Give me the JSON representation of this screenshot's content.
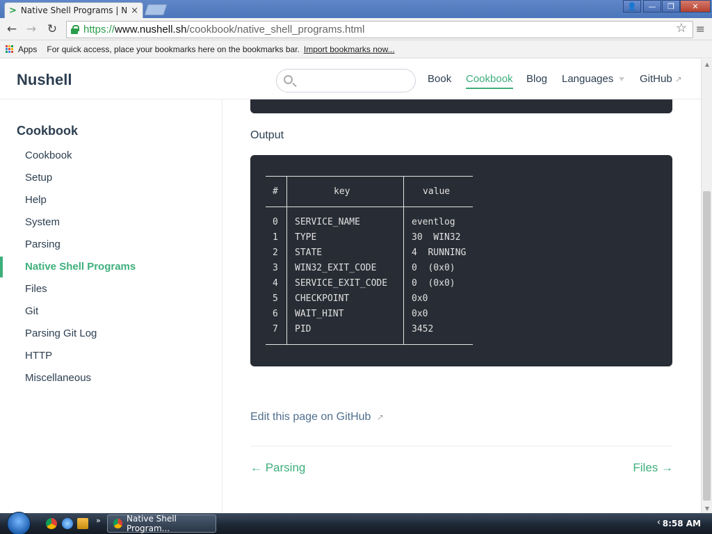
{
  "browser": {
    "tab_title": "Native Shell Programs | Nu",
    "tab_close": "×",
    "window_controls": [
      "👤",
      "—",
      "❐",
      "✕"
    ],
    "url_https": "https://",
    "url_host": "www.nushell.sh",
    "url_path": "/cookbook/native_shell_programs.html",
    "bookmarks": {
      "apps_label": "Apps",
      "hint": "For quick access, place your bookmarks here on the bookmarks bar.",
      "import_link": "Import bookmarks now..."
    }
  },
  "site": {
    "brand": "Nushell",
    "search_placeholder": "",
    "nav": [
      {
        "label": "Book"
      },
      {
        "label": "Cookbook"
      },
      {
        "label": "Blog"
      },
      {
        "label": "Languages"
      },
      {
        "label": "GitHub"
      }
    ]
  },
  "sidebar": {
    "title": "Cookbook",
    "items": [
      {
        "label": "Cookbook"
      },
      {
        "label": "Setup"
      },
      {
        "label": "Help"
      },
      {
        "label": "System"
      },
      {
        "label": "Parsing"
      },
      {
        "label": "Native Shell Programs"
      },
      {
        "label": "Files"
      },
      {
        "label": "Git"
      },
      {
        "label": "Parsing Git Log"
      },
      {
        "label": "HTTP"
      },
      {
        "label": "Miscellaneous"
      }
    ]
  },
  "content": {
    "output_label": "Output",
    "table": {
      "headers": [
        "#",
        "key",
        "value"
      ],
      "rows": [
        [
          "0",
          "SERVICE_NAME",
          "eventlog"
        ],
        [
          "1",
          "TYPE",
          "30  WIN32"
        ],
        [
          "2",
          "STATE",
          "4  RUNNING"
        ],
        [
          "3",
          "WIN32_EXIT_CODE",
          "0  (0x0)"
        ],
        [
          "4",
          "SERVICE_EXIT_CODE",
          "0  (0x0)"
        ],
        [
          "5",
          "CHECKPOINT",
          "0x0"
        ],
        [
          "6",
          "WAIT_HINT",
          "0x0"
        ],
        [
          "7",
          "PID",
          "3452"
        ]
      ]
    },
    "edit_link": "Edit this page on GitHub",
    "prev_link": "← Parsing",
    "next_link": "Files →"
  },
  "taskbar": {
    "task_label": "Native Shell Program...",
    "clock": "8:58 AM",
    "tray_arrow": "‹",
    "quicklaunch_more": "»"
  }
}
